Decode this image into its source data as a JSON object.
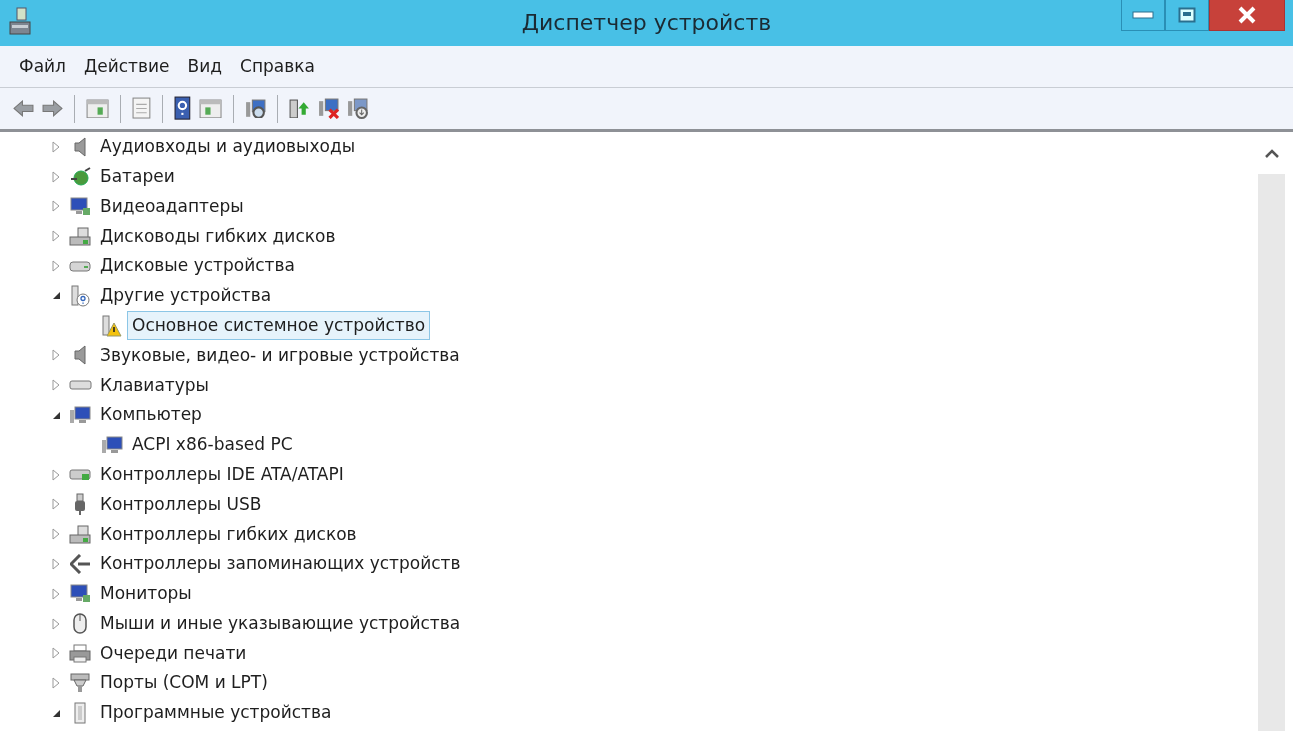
{
  "window": {
    "title": "Диспетчер устройств"
  },
  "menu": [
    {
      "label": "Файл"
    },
    {
      "label": "Действие"
    },
    {
      "label": "Вид"
    },
    {
      "label": "Справка"
    }
  ],
  "tree": [
    {
      "label": "Аудиовходы и аудиовыходы",
      "kind": "speaker",
      "expanded": false,
      "selected": false
    },
    {
      "label": "Батареи",
      "kind": "battery",
      "expanded": false,
      "selected": false
    },
    {
      "label": "Видеоадаптеры",
      "kind": "display",
      "expanded": false,
      "selected": false
    },
    {
      "label": "Дисководы гибких дисков",
      "kind": "floppy",
      "expanded": false,
      "selected": false
    },
    {
      "label": "Дисковые устройства",
      "kind": "disk",
      "expanded": false,
      "selected": false
    },
    {
      "label": "Другие устройства",
      "kind": "unknown",
      "expanded": true,
      "selected": false,
      "children": [
        {
          "label": "Основное системное устройство",
          "kind": "warning",
          "selected": true
        }
      ]
    },
    {
      "label": "Звуковые, видео- и игровые устройства",
      "kind": "speaker",
      "expanded": false,
      "selected": false
    },
    {
      "label": "Клавиатуры",
      "kind": "keyboard",
      "expanded": false,
      "selected": false
    },
    {
      "label": "Компьютер",
      "kind": "computer",
      "expanded": true,
      "selected": false,
      "children": [
        {
          "label": "ACPI x86-based PC",
          "kind": "computer",
          "selected": false
        }
      ]
    },
    {
      "label": "Контроллеры IDE ATA/ATAPI",
      "kind": "ide",
      "expanded": false,
      "selected": false
    },
    {
      "label": "Контроллеры USB",
      "kind": "usb",
      "expanded": false,
      "selected": false
    },
    {
      "label": "Контроллеры гибких дисков",
      "kind": "floppy",
      "expanded": false,
      "selected": false
    },
    {
      "label": "Контроллеры запоминающих устройств",
      "kind": "storage",
      "expanded": false,
      "selected": false
    },
    {
      "label": "Мониторы",
      "kind": "display",
      "expanded": false,
      "selected": false
    },
    {
      "label": "Мыши и иные указывающие устройства",
      "kind": "mouse",
      "expanded": false,
      "selected": false
    },
    {
      "label": "Очереди печати",
      "kind": "printer",
      "expanded": false,
      "selected": false
    },
    {
      "label": "Порты (COM и LPT)",
      "kind": "port",
      "expanded": false,
      "selected": false
    },
    {
      "label": "Программные устройства",
      "kind": "software",
      "expanded": true,
      "selected": false
    }
  ]
}
